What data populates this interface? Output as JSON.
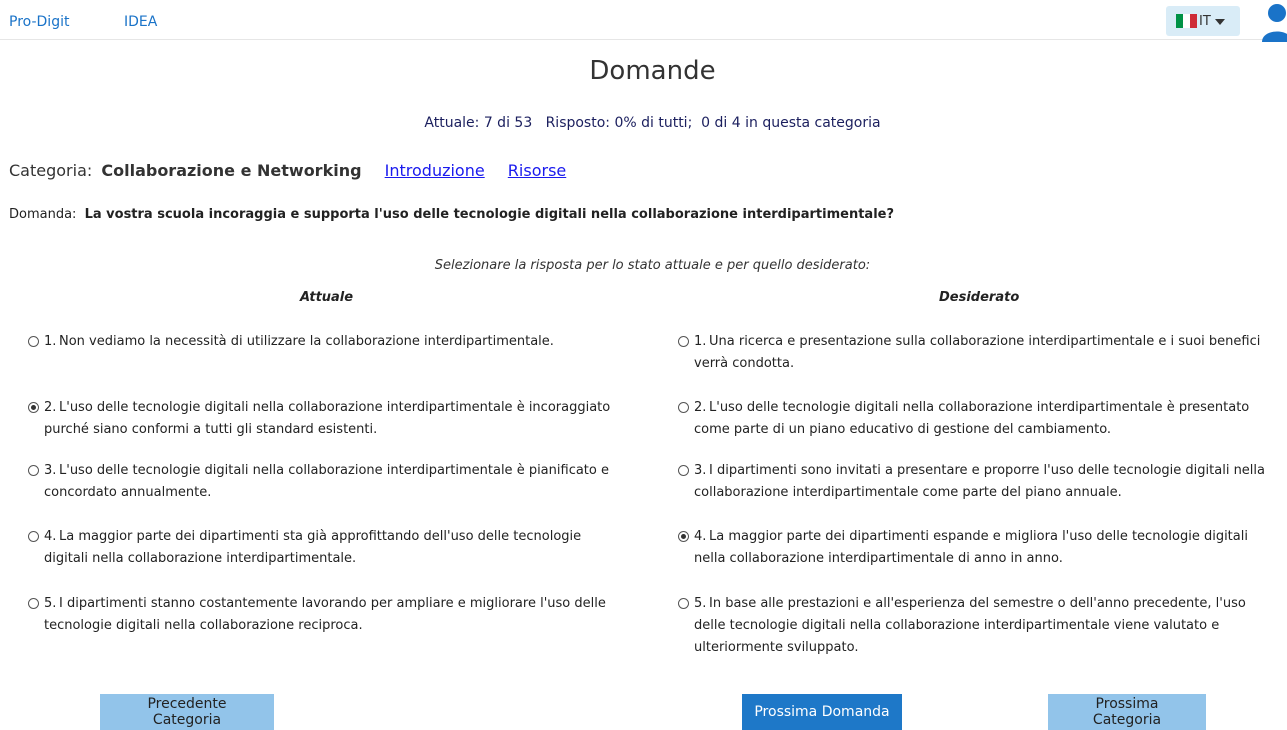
{
  "nav": {
    "brand": "Pro-Digit",
    "idea": "IDEA",
    "language_code": "IT",
    "flag_colors": [
      "#009246",
      "#ffffff",
      "#ce2b37"
    ]
  },
  "header": {
    "title": "Domande",
    "progress": "Attuale: 7 di 53   Risposto: 0% di tutti;  0 di 4 in questa categoria"
  },
  "category": {
    "label": "Categoria:",
    "name": "Collaborazione e Networking",
    "intro_link": "Introduzione",
    "resources_link": "Risorse"
  },
  "question": {
    "label": "Domanda:",
    "text": "La vostra scuola incoraggia e supporta l'uso delle tecnologie digitali nella collaborazione interdipartimentale?"
  },
  "instructions": "Selezionare la risposta per lo stato attuale e per quello desiderato:",
  "columns": {
    "current_title": "Attuale",
    "desired_title": "Desiderato"
  },
  "current_options": [
    {
      "num": "1.",
      "text": "Non vediamo la necessità di utilizzare la collaborazione interdipartimentale.",
      "checked": false
    },
    {
      "num": "2.",
      "text": "L'uso delle tecnologie digitali nella collaborazione interdipartimentale è incoraggiato purché siano conformi a tutti gli standard esistenti.",
      "checked": true
    },
    {
      "num": "3.",
      "text": "L'uso delle tecnologie digitali nella collaborazione interdipartimentale è pianificato e concordato annualmente.",
      "checked": false
    },
    {
      "num": "4.",
      "text": "La maggior parte dei dipartimenti sta già approfittando dell'uso delle tecnologie digitali nella collaborazione interdipartimentale.",
      "checked": false
    },
    {
      "num": "5.",
      "text": "I dipartimenti stanno costantemente lavorando per ampliare e migliorare l'uso delle tecnologie digitali nella collaborazione reciproca.",
      "checked": false
    }
  ],
  "desired_options": [
    {
      "num": "1.",
      "text": "Una ricerca e presentazione sulla collaborazione interdipartimentale e i suoi benefici verrà condotta.",
      "checked": false
    },
    {
      "num": "2.",
      "text": "L'uso delle tecnologie digitali nella collaborazione interdipartimentale è presentato come parte di un piano educativo di gestione del cambiamento.",
      "checked": false
    },
    {
      "num": "3.",
      "text": "I dipartimenti sono invitati a presentare e proporre l'uso delle tecnologie digitali nella collaborazione interdipartimentale come parte del piano annuale.",
      "checked": false
    },
    {
      "num": "4.",
      "text": "La maggior parte dei dipartimenti espande e migliora l'uso delle tecnologie digitali nella collaborazione interdipartimentale di anno in anno.",
      "checked": true
    },
    {
      "num": "5.",
      "text": "In base alle prestazioni e all'esperienza del semestre o dell'anno precedente, l'uso delle tecnologie digitali nella collaborazione interdipartimentale viene valutato e ulteriormente sviluppato.",
      "checked": false
    }
  ],
  "buttons": {
    "prev_category": "Precedente Categoria",
    "next_question": "Prossima Domanda",
    "next_category": "Prossima Categoria"
  }
}
